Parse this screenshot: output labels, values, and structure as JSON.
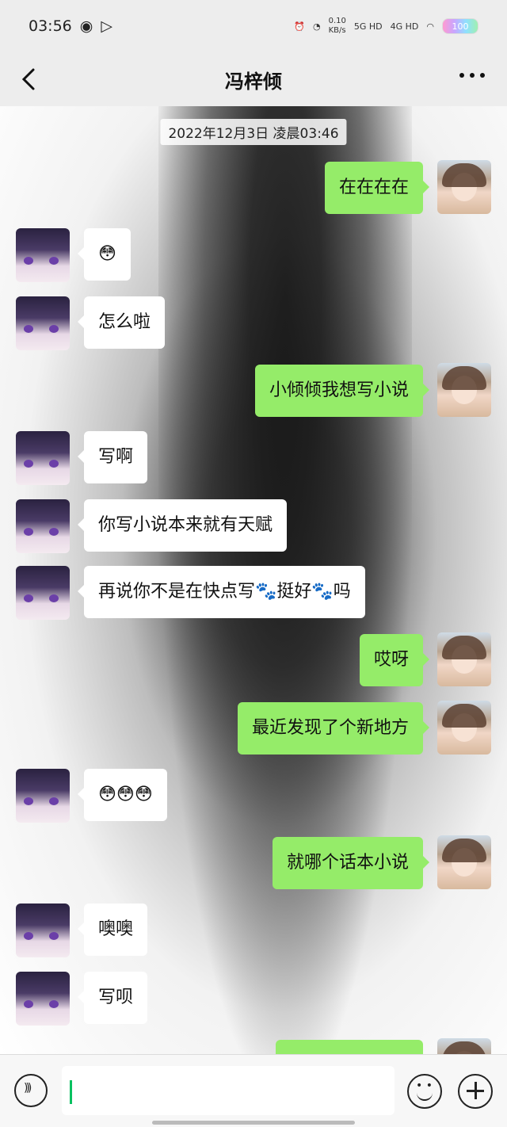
{
  "status_bar": {
    "time": "03:56",
    "network_speed": "0.10",
    "network_unit": "KB/s",
    "signal_1": "5G HD",
    "signal_2": "4G HD",
    "battery": "100"
  },
  "header": {
    "title": "冯梓倾",
    "back_icon": "chevron-left-icon",
    "more_icon": "more-dots-icon"
  },
  "chat": {
    "timestamp": "2022年12月3日 凌晨03:46",
    "messages": [
      {
        "side": "right",
        "text": "在在在在"
      },
      {
        "side": "left",
        "text": "😳"
      },
      {
        "side": "left",
        "text": "怎么啦"
      },
      {
        "side": "right",
        "text": "小倾倾我想写小说"
      },
      {
        "side": "left",
        "text": "写啊"
      },
      {
        "side": "left",
        "text": "你写小说本来就有天赋"
      },
      {
        "side": "left",
        "text": "再说你不是在快点写🐾挺好🐾吗"
      },
      {
        "side": "right",
        "text": "哎呀"
      },
      {
        "side": "right",
        "text": "最近发现了个新地方"
      },
      {
        "side": "left",
        "text": "😳😳😳"
      },
      {
        "side": "right",
        "text": "就哪个话本小说"
      },
      {
        "side": "left",
        "text": "噢噢"
      },
      {
        "side": "left",
        "text": "写呗"
      }
    ]
  },
  "input_bar": {
    "voice_icon": "voice-icon",
    "emoji_icon": "emoji-icon",
    "plus_icon": "plus-icon",
    "input_value": ""
  }
}
